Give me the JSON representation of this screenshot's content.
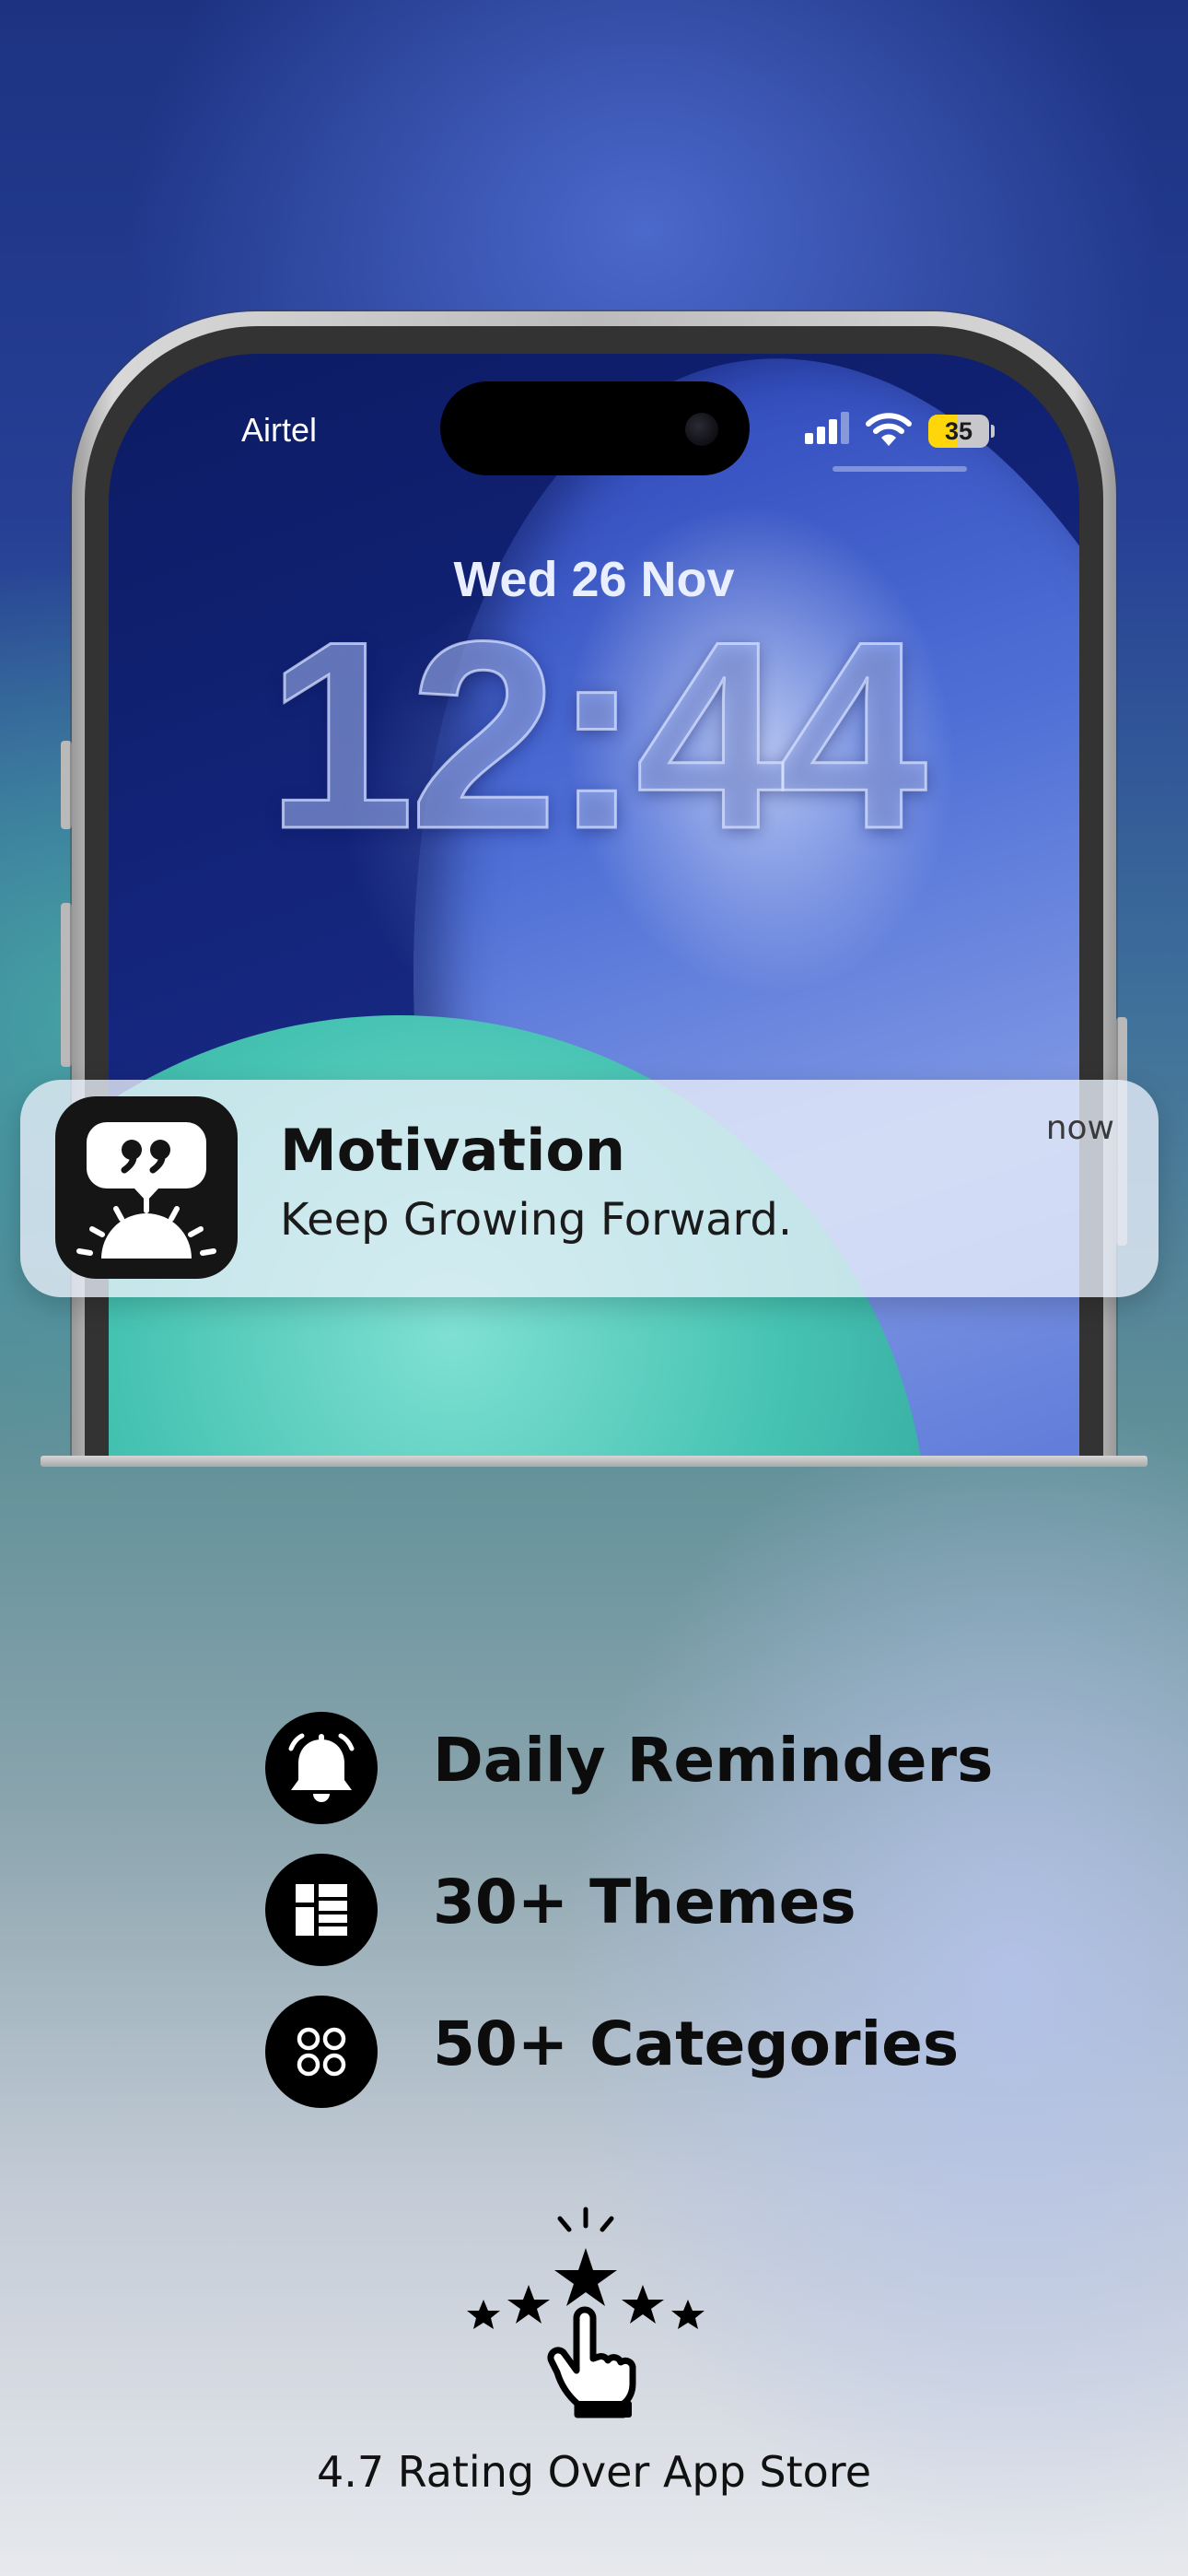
{
  "status_bar": {
    "carrier": "Airtel",
    "battery": "35",
    "icons": [
      "signal-icon",
      "wifi-icon",
      "battery-icon"
    ],
    "battery_color": "#ffd60a"
  },
  "lock_screen": {
    "date": "Wed 26 Nov",
    "time": "12:44"
  },
  "notification": {
    "app_icon": "quote-sunrise-icon",
    "title": "Motivation",
    "body": "Keep Growing Forward.",
    "time": "now"
  },
  "features": [
    {
      "icon": "bell-icon",
      "label": "Daily Reminders"
    },
    {
      "icon": "themes-grid-icon",
      "label": "30+ Themes"
    },
    {
      "icon": "categories-icon",
      "label": "50+ Categories"
    }
  ],
  "rating": {
    "icon": "stars-tap-icon",
    "text": "4.7 Rating Over App Store"
  },
  "colors": {
    "teal_accent": "#46c3b3",
    "blue_background": "#263f95",
    "icon_black": "#000000"
  }
}
